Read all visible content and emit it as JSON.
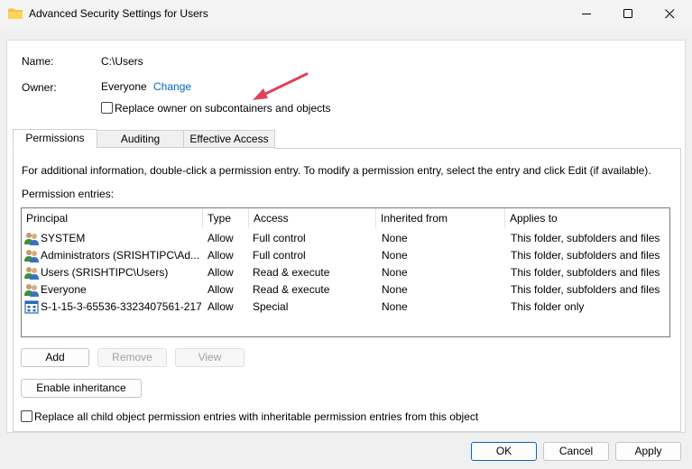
{
  "window": {
    "title": "Advanced Security Settings for Users",
    "minimize_icon": "minimize-icon",
    "maximize_icon": "maximize-icon",
    "close_icon": "close-icon"
  },
  "info": {
    "name_label": "Name:",
    "name_value": "C:\\Users",
    "owner_label": "Owner:",
    "owner_value": "Everyone",
    "change_link": "Change",
    "replace_owner_label": "Replace owner on subcontainers and objects",
    "replace_owner_checked": false
  },
  "tabs": [
    {
      "label": "Permissions",
      "active": true
    },
    {
      "label": "Auditing",
      "active": false
    },
    {
      "label": "Effective Access",
      "active": false
    }
  ],
  "permissions": {
    "description": "For additional information, double-click a permission entry. To modify a permission entry, select the entry and click Edit (if available).",
    "entries_label": "Permission entries:",
    "columns": [
      "Principal",
      "Type",
      "Access",
      "Inherited from",
      "Applies to"
    ],
    "rows": [
      {
        "icon": "user-group-icon",
        "principal": "SYSTEM",
        "type": "Allow",
        "access": "Full control",
        "inherited": "None",
        "applies": "This folder, subfolders and files"
      },
      {
        "icon": "user-group-icon",
        "principal": "Administrators (SRISHTIPC\\Ad...",
        "type": "Allow",
        "access": "Full control",
        "inherited": "None",
        "applies": "This folder, subfolders and files"
      },
      {
        "icon": "user-group-icon",
        "principal": "Users (SRISHTIPC\\Users)",
        "type": "Allow",
        "access": "Read & execute",
        "inherited": "None",
        "applies": "This folder, subfolders and files"
      },
      {
        "icon": "user-group-icon",
        "principal": "Everyone",
        "type": "Allow",
        "access": "Read & execute",
        "inherited": "None",
        "applies": "This folder, subfolders and files"
      },
      {
        "icon": "app-package-icon",
        "principal": "S-1-15-3-65536-3323407561-217...",
        "type": "Allow",
        "access": "Special",
        "inherited": "None",
        "applies": "This folder only"
      }
    ],
    "add_button": "Add",
    "remove_button": "Remove",
    "view_button": "View",
    "enable_inheritance_button": "Enable inheritance",
    "replace_child_label": "Replace all child object permission entries with inheritable permission entries from this object",
    "replace_child_checked": false
  },
  "footer": {
    "ok_button": "OK",
    "cancel_button": "Cancel",
    "apply_button": "Apply"
  },
  "colors": {
    "link": "#0067c0",
    "annotation_arrow": "#e0435a"
  }
}
